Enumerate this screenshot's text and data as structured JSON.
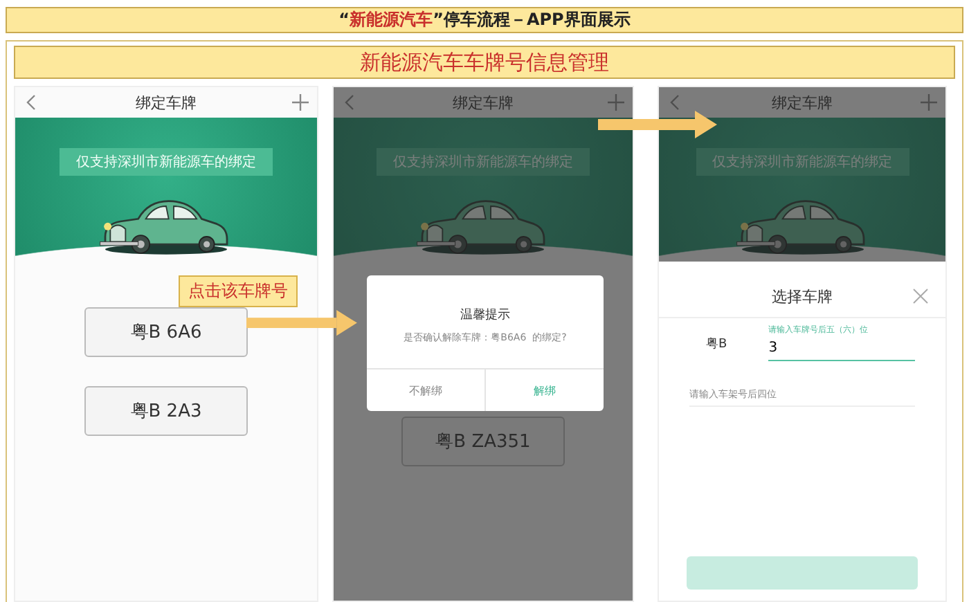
{
  "slide": {
    "title": "“**新能源汽车**”停车流程－APP界面展示",
    "subtitle": "新能源汽车车牌号信息管理"
  },
  "screens": [
    {
      "kind": "list",
      "dimmed": false,
      "nav": {
        "title": "绑定车牌"
      },
      "banner": {
        "ribbon": "仅支持深圳市新能源车的绑定"
      },
      "plates": [
        "粤B 6A6",
        "粤B 2A3"
      ],
      "callout": "点击该车牌号"
    },
    {
      "kind": "dialog",
      "dimmed": true,
      "nav": {
        "title": "绑定车牌"
      },
      "banner": {
        "ribbon": "仅支持深圳市新能源车的绑定"
      },
      "plates": [
        "粤B ZA351"
      ],
      "dialog": {
        "title": "温馨提示",
        "message": "是否确认解除车牌：粤B6A6  的绑定?",
        "buttons": [
          {
            "label": "不解绑",
            "primary": false
          },
          {
            "label": "解绑",
            "primary": true
          }
        ]
      }
    },
    {
      "kind": "sheet",
      "dimmed": true,
      "nav": {
        "title": "绑定车牌"
      },
      "banner": {
        "ribbon": "仅支持深圳市新能源车的绑定"
      },
      "sheet": {
        "title": "选择车牌",
        "prefix": "粤B",
        "plate_field": {
          "label": "请输入车牌号后五（六）位",
          "value": "3"
        },
        "frame_field": {
          "placeholder": "请输入车架号后四位"
        },
        "confirm": {
          "disabled": true
        }
      }
    }
  ]
}
